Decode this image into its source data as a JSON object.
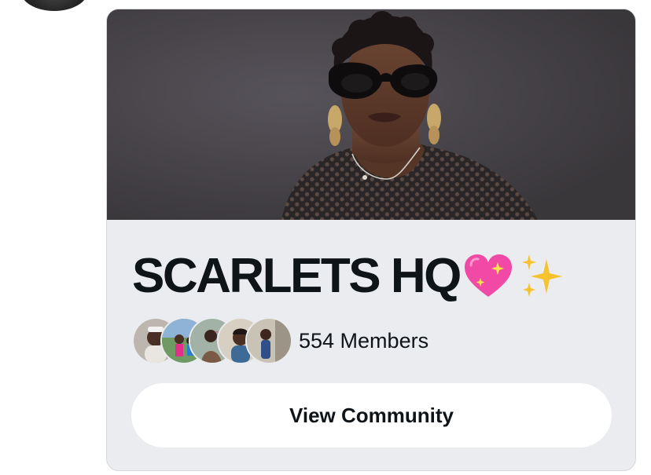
{
  "author": {
    "avatar_icon": "avatar"
  },
  "community": {
    "name": "SCARLETS HQ",
    "name_emojis": [
      "sparkling-heart",
      "sparkles"
    ],
    "member_count_label": "554 Members",
    "view_button_label": "View Community"
  },
  "colors": {
    "card_background": "#ebecef",
    "title_text": "#0f1419",
    "button_background": "#ffffff",
    "heart_pink": "#f04aa6",
    "sparkle_gold": "#f6c22d"
  }
}
